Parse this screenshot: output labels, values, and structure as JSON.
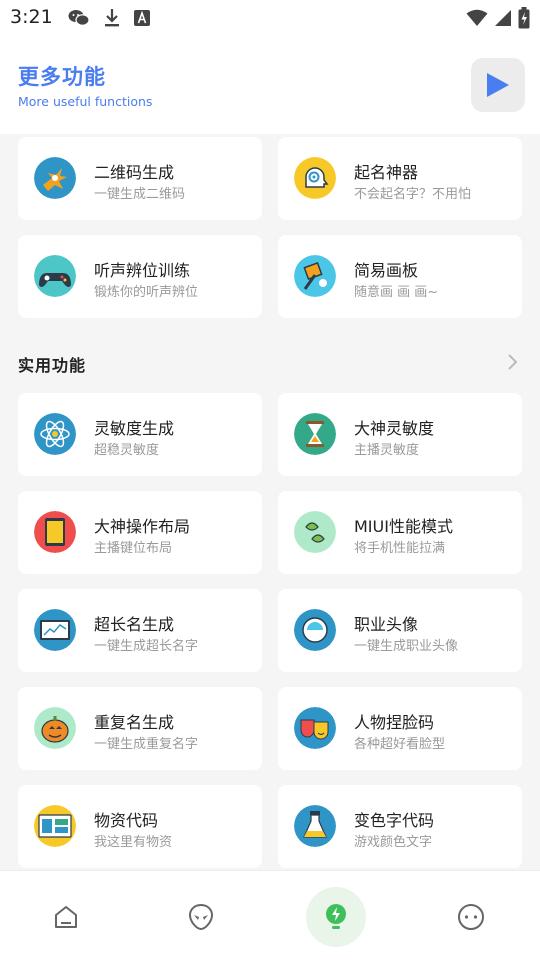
{
  "status_bar": {
    "time": "3:21"
  },
  "header": {
    "title": "更多功能",
    "subtitle": "More useful functions",
    "play_icon": "play-icon"
  },
  "top_cards": [
    {
      "title": "二维码生成",
      "subtitle": "一键生成二维码",
      "icon": "qrcode-icon"
    },
    {
      "title": "起名神器",
      "subtitle": "不会起名字？不用怕",
      "icon": "brain-icon"
    },
    {
      "title": "听声辨位训练",
      "subtitle": "锻炼你的听声辨位",
      "icon": "gamepad-icon"
    },
    {
      "title": "简易画板",
      "subtitle": "随意画 画 画~",
      "icon": "paint-icon"
    }
  ],
  "section": {
    "title": "实用功能"
  },
  "practical_cards": [
    {
      "title": "灵敏度生成",
      "subtitle": "超稳灵敏度",
      "icon": "atom-icon"
    },
    {
      "title": "大神灵敏度",
      "subtitle": "主播灵敏度",
      "icon": "hourglass-icon"
    },
    {
      "title": "大神操作布局",
      "subtitle": "主播键位布局",
      "icon": "tablet-icon"
    },
    {
      "title": "MIUI性能模式",
      "subtitle": "将手机性能拉满",
      "icon": "leaf-icon"
    },
    {
      "title": "超长名生成",
      "subtitle": "一键生成超长名字",
      "icon": "monitor-icon"
    },
    {
      "title": "职业头像",
      "subtitle": "一键生成职业头像",
      "icon": "astronaut-icon"
    },
    {
      "title": "重复名生成",
      "subtitle": "一键生成重复名字",
      "icon": "pumpkin-icon"
    },
    {
      "title": "人物捏脸码",
      "subtitle": "各种超好看脸型",
      "icon": "masks-icon"
    },
    {
      "title": "物资代码",
      "subtitle": "我这里有物资",
      "icon": "layout-icon"
    },
    {
      "title": "变色字代码",
      "subtitle": "游戏颜色文字",
      "icon": "flask-icon"
    }
  ],
  "bottom_nav": [
    {
      "icon": "home-icon",
      "active": false
    },
    {
      "icon": "alien-icon",
      "active": false
    },
    {
      "icon": "bulb-icon",
      "active": true
    },
    {
      "icon": "more-icon",
      "active": false
    }
  ],
  "colors": {
    "accent": "#4a7df0",
    "active_nav": "#3fbf5a",
    "background": "#f5f5f5"
  }
}
